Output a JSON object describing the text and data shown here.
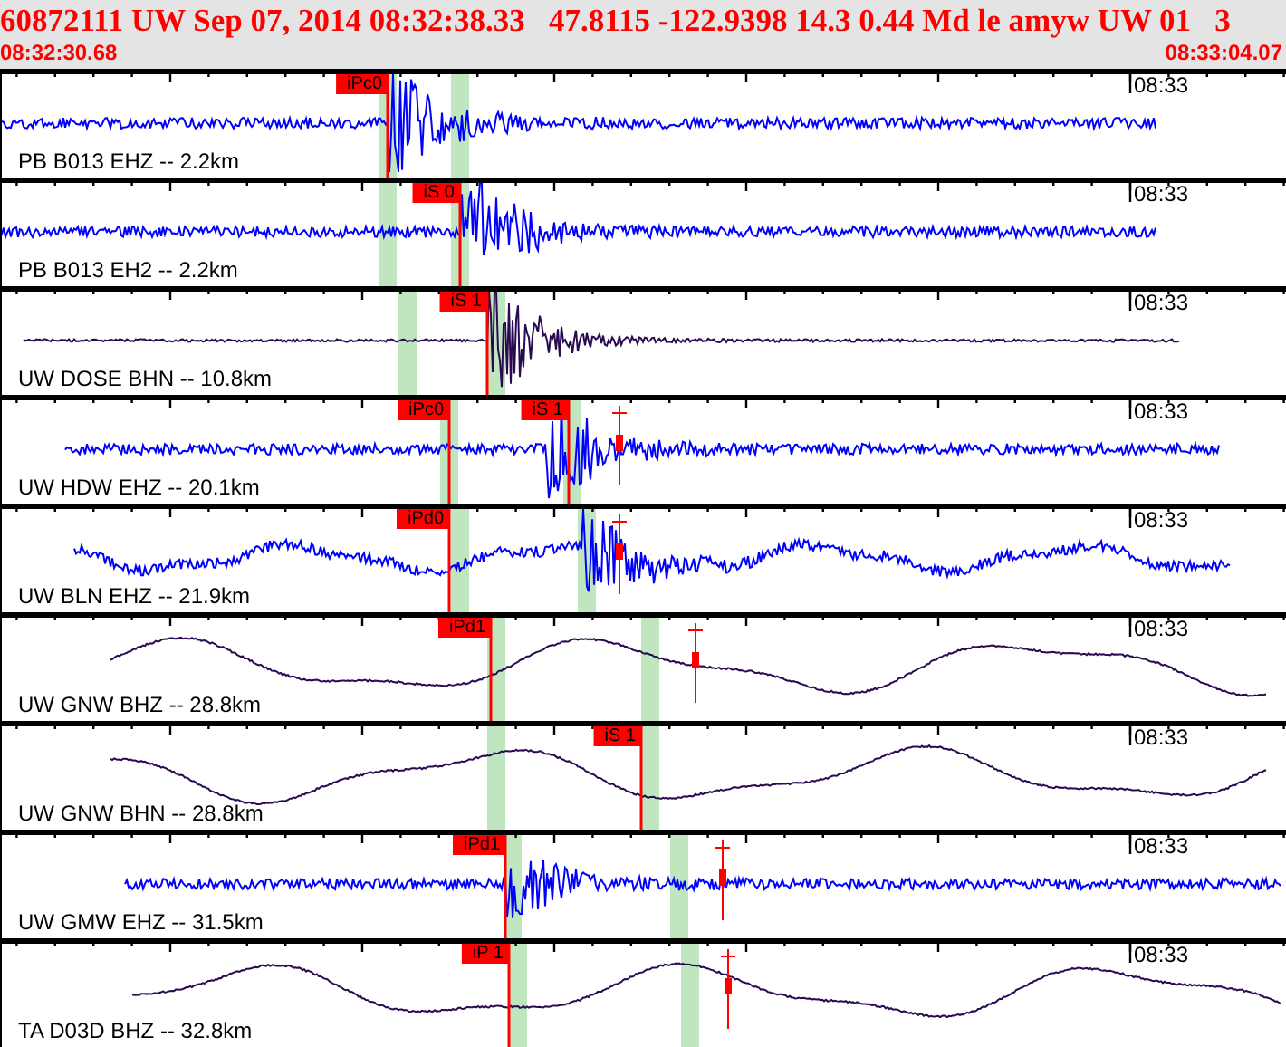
{
  "header": {
    "event_line": "60872111 UW Sep 07, 2014 08:32:38.33   47.8115 -122.9398 14.3 0.44 Md le amyw UW 01   3",
    "start_time": "08:32:30.68",
    "end_time": "08:33:04.07"
  },
  "traces": [
    {
      "channel": "PB B013 EHZ -- 2.2km",
      "time_label": "08:33",
      "color": "#0000ff",
      "picks": [
        {
          "label": "iPc0"
        }
      ]
    },
    {
      "channel": "PB B013 EH2 -- 2.2km",
      "time_label": "08:33",
      "color": "#0000ff",
      "picks": [
        {
          "label": "iS 0"
        }
      ]
    },
    {
      "channel": "UW DOSE BHN -- 10.8km",
      "time_label": "08:33",
      "color": "#2a0a50",
      "picks": [
        {
          "label": "iS 1"
        }
      ]
    },
    {
      "channel": "UW HDW EHZ -- 20.1km",
      "time_label": "08:33",
      "color": "#0000ff",
      "picks": [
        {
          "label": "iPc0"
        },
        {
          "label": "iS 1"
        }
      ]
    },
    {
      "channel": "UW BLN EHZ -- 21.9km",
      "time_label": "08:33",
      "color": "#0000ff",
      "picks": [
        {
          "label": "iPd0"
        }
      ]
    },
    {
      "channel": "UW GNW BHZ -- 28.8km",
      "time_label": "08:33",
      "color": "#2a0a50",
      "picks": [
        {
          "label": "iPd1"
        }
      ]
    },
    {
      "channel": "UW GNW BHN -- 28.8km",
      "time_label": "08:33",
      "color": "#2a0a50",
      "picks": [
        {
          "label": "iS 1"
        }
      ]
    },
    {
      "channel": "UW GMW EHZ -- 31.5km",
      "time_label": "08:33",
      "color": "#0000ff",
      "picks": [
        {
          "label": "iPd1"
        }
      ]
    },
    {
      "channel": "TA D03D BHZ -- 32.8km",
      "time_label": "08:33",
      "color": "#2a0a50",
      "picks": [
        {
          "label": "iP 1"
        }
      ]
    }
  ]
}
